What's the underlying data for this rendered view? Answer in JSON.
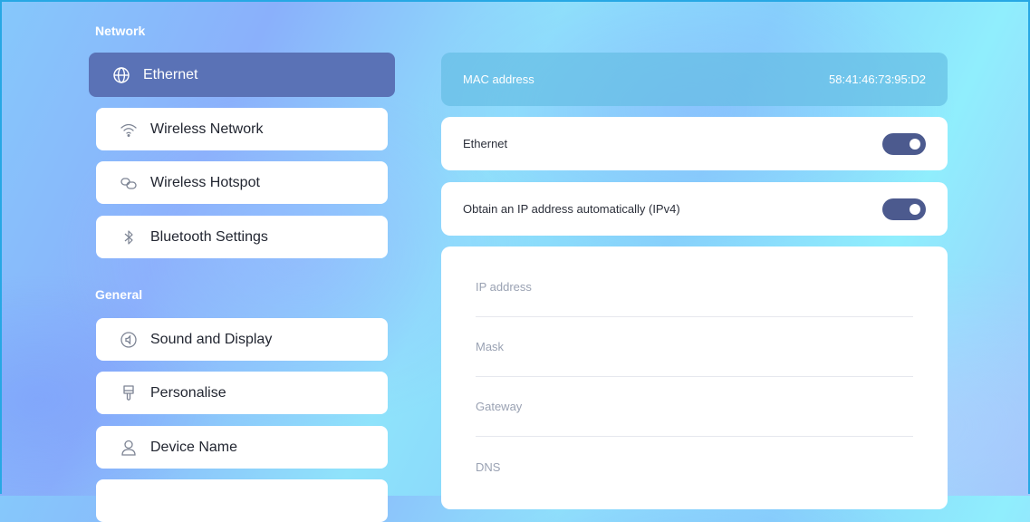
{
  "sections": {
    "network": "Network",
    "general": "General"
  },
  "nav": {
    "network_items": [
      {
        "label": "Ethernet",
        "icon": "globe-icon",
        "active": true
      },
      {
        "label": "Wireless Network",
        "icon": "wifi-icon",
        "active": false
      },
      {
        "label": "Wireless Hotspot",
        "icon": "hotspot-icon",
        "active": false
      },
      {
        "label": "Bluetooth Settings",
        "icon": "bluetooth-icon",
        "active": false
      }
    ],
    "general_items": [
      {
        "label": "Sound and Display",
        "icon": "sound-icon"
      },
      {
        "label": "Personalise",
        "icon": "brush-icon"
      },
      {
        "label": "Device Name",
        "icon": "user-icon"
      }
    ]
  },
  "detail": {
    "mac": {
      "label": "MAC address",
      "value": "58:41:46:73:95:D2"
    },
    "ethernet_toggle": {
      "label": "Ethernet",
      "on": true
    },
    "dhcp_toggle": {
      "label": "Obtain an IP address automatically (IPv4)",
      "on": true
    },
    "fields": [
      {
        "label": "IP address"
      },
      {
        "label": "Mask"
      },
      {
        "label": "Gateway"
      },
      {
        "label": "DNS"
      }
    ]
  },
  "colors": {
    "active_item": "#5a72b6",
    "toggle_on": "#4c5a8e",
    "frame": "#27a8e4"
  }
}
